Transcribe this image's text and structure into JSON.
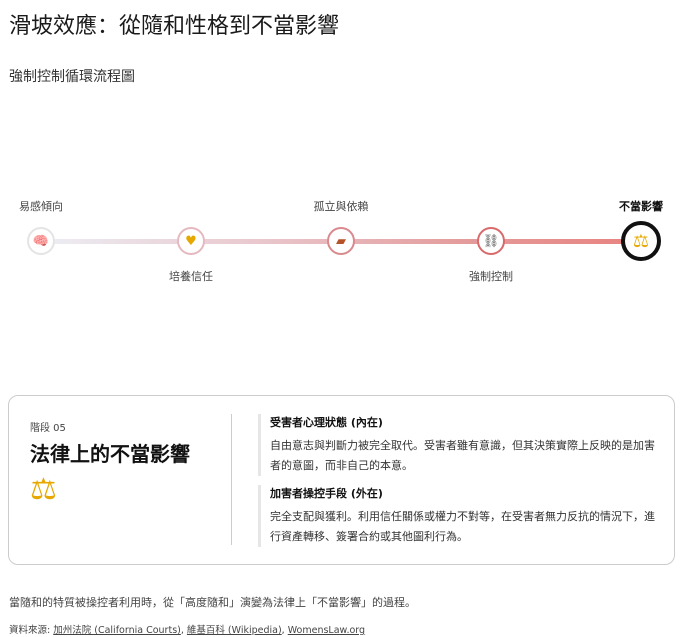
{
  "title": "滑坡效應：從隨和性格到不當影響",
  "subtitle": "強制控制循環流程圖",
  "steps": [
    {
      "label": "易感傾向",
      "icon": "brain-icon",
      "glyph": "🧠"
    },
    {
      "label": "培養信任",
      "icon": "heart-icon",
      "glyph": "♥"
    },
    {
      "label": "孤立與依賴",
      "icon": "brick-icon",
      "glyph": "▰"
    },
    {
      "label": "強制控制",
      "icon": "chain-link-icon",
      "glyph": "⛓"
    },
    {
      "label": "不當影響",
      "icon": "balance-scale-icon",
      "glyph": "⚖"
    }
  ],
  "card": {
    "stage": "階段 05",
    "title": "法律上的不當影響",
    "icon_glyph": "⚖",
    "sections": [
      {
        "heading": "受害者心理狀態 (內在)",
        "text": "自由意志與判斷力被完全取代。受害者雖有意識，但其決策實際上反映的是加害者的意圖，而非自己的本意。"
      },
      {
        "heading": "加害者操控手段 (外在)",
        "text": "完全支配與獲利。利用信任關係或權力不對等，在受害者無力反抗的情況下，進行資產轉移、簽署合約或其他圖利行為。"
      }
    ]
  },
  "footer": "當隨和的特質被操控者利用時，從「高度隨和」演變為法律上「不當影響」的過程。",
  "sources": {
    "label": "資料來源:",
    "links": [
      "加州法院 (California Courts)",
      "維基百科 (Wikipedia)",
      "WomensLaw.org"
    ]
  },
  "colors": {
    "accent": "#e8827f",
    "gold": "#e6a800"
  }
}
